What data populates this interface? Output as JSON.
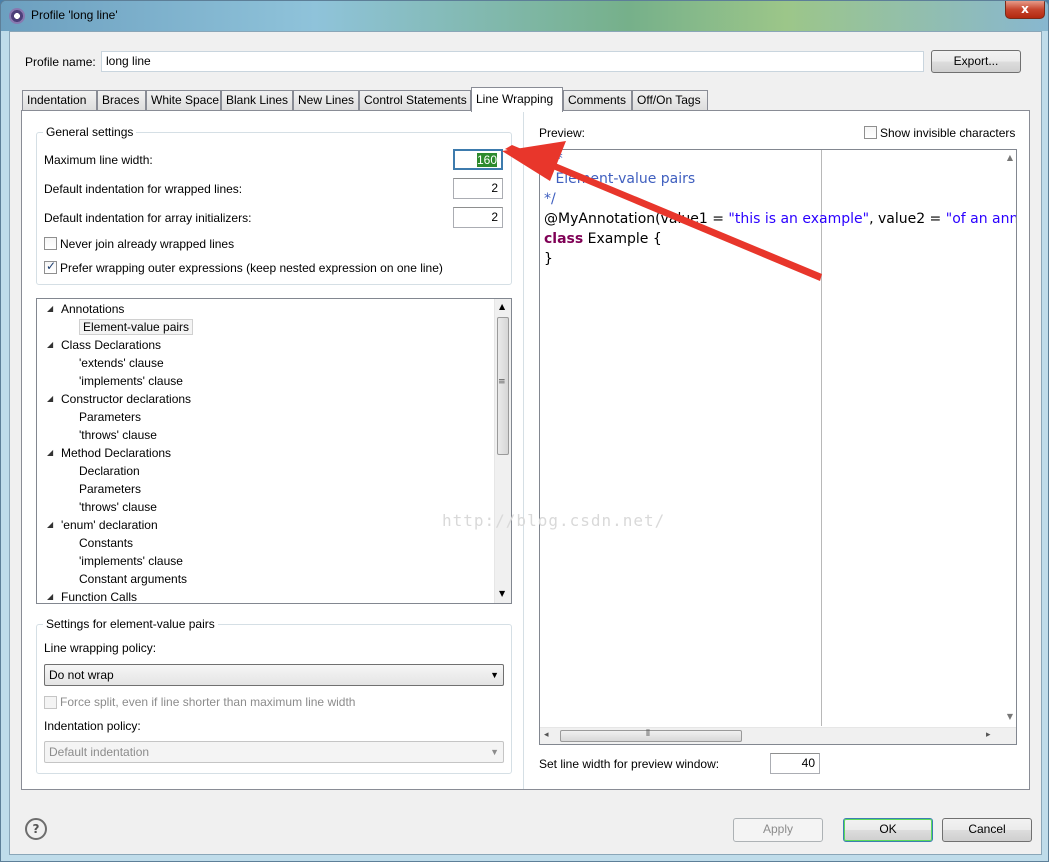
{
  "window": {
    "title": "Profile 'long line'",
    "close_glyph": "x"
  },
  "profile": {
    "name_label": "Profile name:",
    "name_value": "long line",
    "export_button": "Export..."
  },
  "tabs": [
    {
      "label": "Indentation"
    },
    {
      "label": "Braces"
    },
    {
      "label": "White Space"
    },
    {
      "label": "Blank Lines"
    },
    {
      "label": "New Lines"
    },
    {
      "label": "Control Statements"
    },
    {
      "label": "Line Wrapping"
    },
    {
      "label": "Comments"
    },
    {
      "label": "Off/On Tags"
    }
  ],
  "general": {
    "title": "General settings",
    "max_width_label": "Maximum line width:",
    "max_width_value": "160",
    "default_indent_label": "Default indentation for wrapped lines:",
    "default_indent_value": "2",
    "array_indent_label": "Default indentation for array initializers:",
    "array_indent_value": "2",
    "never_join_label": "Never join already wrapped lines",
    "never_join_checked": false,
    "prefer_outer_label": "Prefer wrapping outer expressions (keep nested expression on one line)",
    "prefer_outer_checked": true
  },
  "tree": {
    "items": [
      {
        "label": "Annotations",
        "level": 0,
        "expanded": true
      },
      {
        "label": "Element-value pairs",
        "level": 1,
        "selected": true
      },
      {
        "label": "Class Declarations",
        "level": 0,
        "expanded": true
      },
      {
        "label": "'extends' clause",
        "level": 1
      },
      {
        "label": "'implements' clause",
        "level": 1
      },
      {
        "label": "Constructor declarations",
        "level": 0,
        "expanded": true
      },
      {
        "label": "Parameters",
        "level": 1
      },
      {
        "label": "'throws' clause",
        "level": 1
      },
      {
        "label": "Method Declarations",
        "level": 0,
        "expanded": true
      },
      {
        "label": "Declaration",
        "level": 1
      },
      {
        "label": "Parameters",
        "level": 1
      },
      {
        "label": "'throws' clause",
        "level": 1
      },
      {
        "label": "'enum' declaration",
        "level": 0,
        "expanded": true
      },
      {
        "label": "Constants",
        "level": 1
      },
      {
        "label": "'implements' clause",
        "level": 1
      },
      {
        "label": "Constant arguments",
        "level": 1
      },
      {
        "label": "Function Calls",
        "level": 0,
        "expanded": true
      }
    ]
  },
  "element_settings": {
    "title": "Settings for element-value pairs",
    "policy_label": "Line wrapping policy:",
    "policy_value": "Do not wrap",
    "force_split_label": "Force split, even if line shorter than maximum line width",
    "force_split_checked": false,
    "indent_policy_label": "Indentation policy:",
    "indent_policy_value": "Default indentation"
  },
  "preview": {
    "label": "Preview:",
    "show_invisible_label": "Show invisible characters",
    "show_invisible_checked": false,
    "code": {
      "l1": "/**",
      "l2": " * Element-value pairs",
      "l3": " */",
      "l4_a": "@MyAnnotation(value1 = ",
      "l4_s1": "\"this is an example\"",
      "l4_b": ", value2 = ",
      "l4_s2": "\"of an annotation\"",
      "l5_kw": "class",
      "l5_rest": " Example {",
      "l6": "}"
    },
    "line_width_label": "Set line width for preview window:",
    "line_width_value": "40"
  },
  "watermark": "http://blog.csdn.net/",
  "footer": {
    "help_glyph": "?",
    "apply": "Apply",
    "ok": "OK",
    "cancel": "Cancel"
  },
  "annotation": {
    "arrow_color": "#e8362b"
  }
}
